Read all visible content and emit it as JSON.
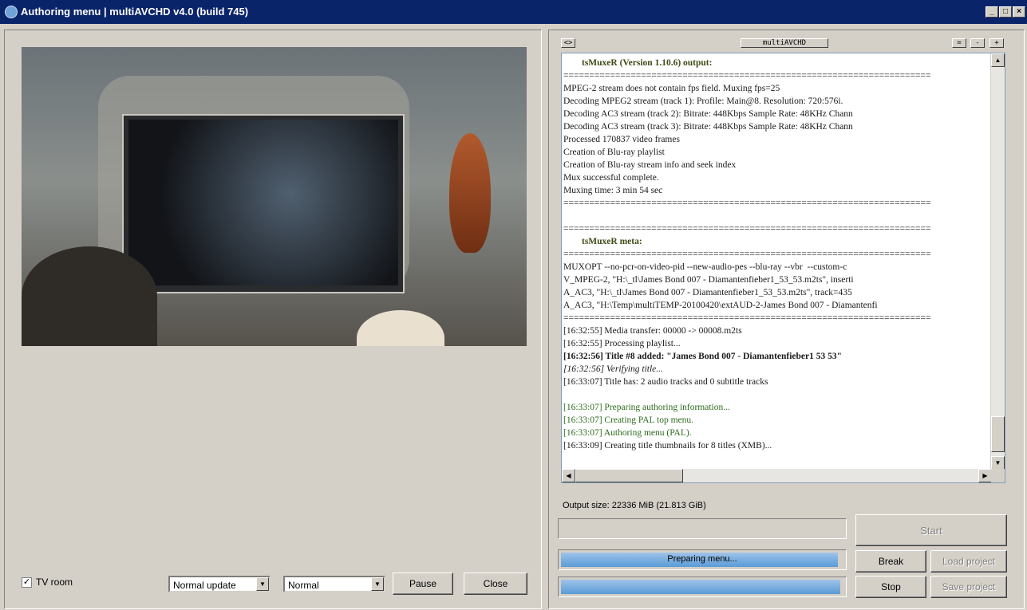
{
  "window": {
    "title": "Authoring menu | multiAVCHD v4.0 (build 745)"
  },
  "preview": {
    "tv_room_label": "TV room",
    "tv_room_checked": true
  },
  "controls": {
    "update_mode": "Normal update",
    "speed": "Normal",
    "pause_label": "Pause",
    "close_label": "Close"
  },
  "log": {
    "toolbar_left": "<>",
    "toolbar_title": "multiAVCHD",
    "toolbar_buttons": [
      "=",
      "-",
      "+"
    ],
    "lines": [
      "        tsMuxeR (Version 1.10.6) output:",
      "=======================================================================",
      "MPEG-2 stream does not contain fps field. Muxing fps=25",
      "Decoding MPEG2 stream (track 1): Profile: Main@8. Resolution: 720:576i.",
      "Decoding AC3 stream (track 2): Bitrate: 448Kbps Sample Rate: 48KHz Chann",
      "Decoding AC3 stream (track 3): Bitrate: 448Kbps Sample Rate: 48KHz Chann",
      "Processed 170837 video frames",
      "Creation of Blu-ray playlist",
      "Creation of Blu-ray stream info and seek index",
      "Mux successful complete.",
      "Muxing time: 3 min 54 sec",
      "=======================================================================",
      "",
      "=======================================================================",
      "        tsMuxeR meta:",
      "=======================================================================",
      "MUXOPT --no-pcr-on-video-pid --new-audio-pes --blu-ray --vbr  --custom-c",
      "V_MPEG-2, \"H:\\_tl\\James Bond 007 - Diamantenfieber1_53_53.m2ts\", inserti",
      "A_AC3, \"H:\\_tl\\James Bond 007 - Diamantenfieber1_53_53.m2ts\", track=435",
      "A_AC3, \"H:\\Temp\\multiTEMP-20100420\\extAUD-2-James Bond 007 - Diamantenfi",
      "=======================================================================",
      "[16:32:55] Media transfer: 00000 -> 00008.m2ts",
      "[16:32:55] Processing playlist...",
      "[16:32:56] Title #8 added: \"James Bond 007 - Diamantenfieber1 53 53\"",
      "[16:32:56] Verifying title...",
      "[16:33:07] Title has: 2 audio tracks and 0 subtitle tracks",
      "",
      "[16:33:07] Preparing authoring information...",
      "[16:33:07] Creating PAL top menu.",
      "[16:33:07] Authoring menu (PAL).",
      "[16:33:09] Creating title thumbnails for 8 titles (XMB)..."
    ]
  },
  "status": {
    "output_size": "Output size: 22336 MiB (21.813 GiB)",
    "progress1_fraction": 0.0,
    "progress2_label": "Preparing menu...",
    "progress2_fraction": 0.98,
    "progress3_fraction": 0.99
  },
  "actions": {
    "start_label": "Start",
    "break_label": "Break",
    "load_label": "Load project",
    "stop_label": "Stop",
    "save_label": "Save project"
  }
}
